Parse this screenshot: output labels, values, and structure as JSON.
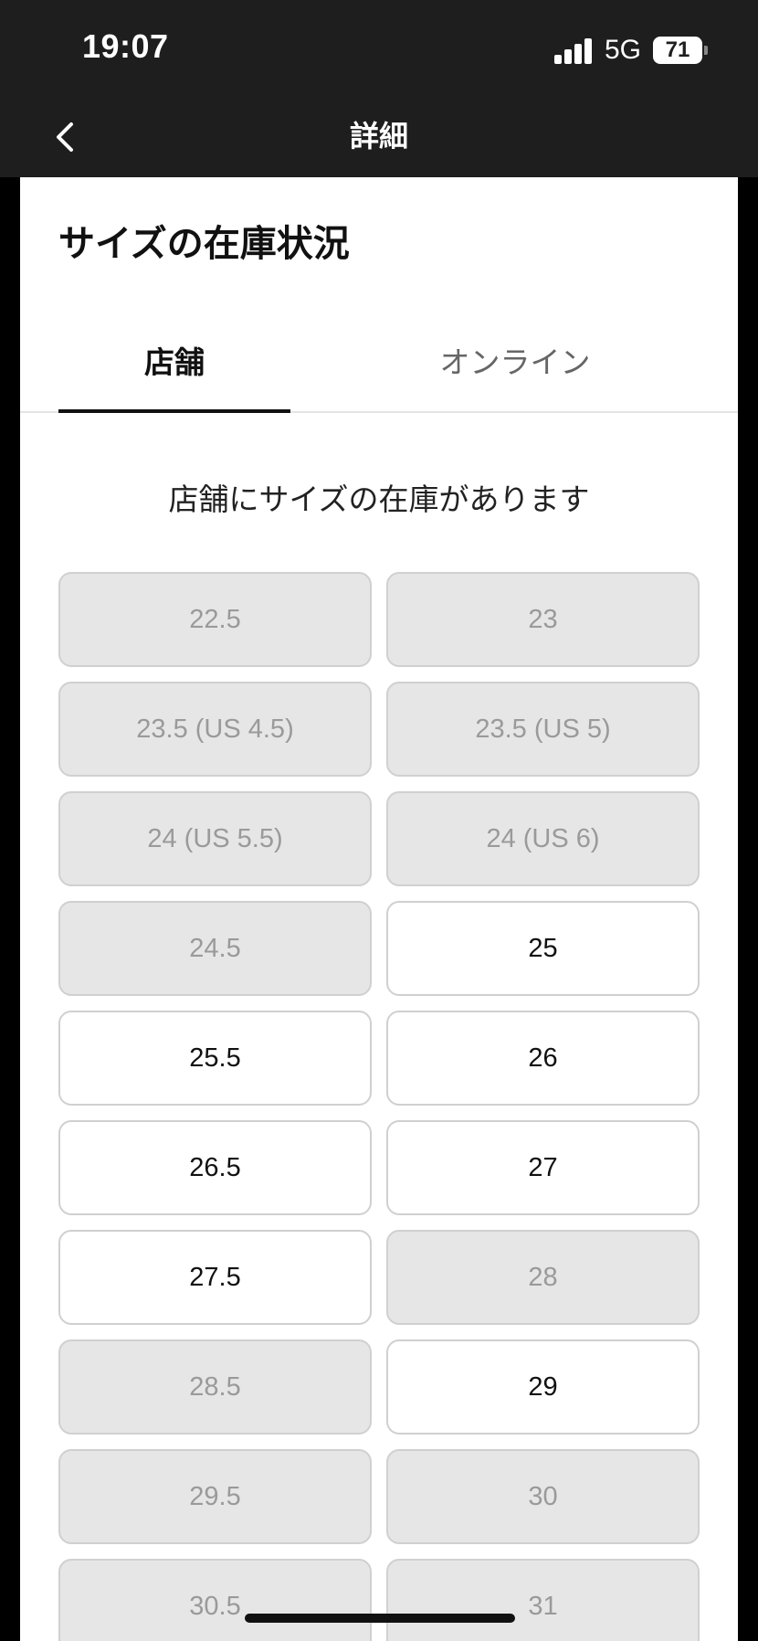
{
  "status_bar": {
    "time": "19:07",
    "network": "5G",
    "battery": "71"
  },
  "nav": {
    "title": "詳細"
  },
  "sheet": {
    "title": "サイズの在庫状況",
    "tabs": [
      {
        "label": "店舗",
        "selected": true
      },
      {
        "label": "オンライン",
        "selected": false
      }
    ],
    "message": "店舗にサイズの在庫があります"
  },
  "sizes": [
    {
      "label": "22.5",
      "available": false
    },
    {
      "label": "23",
      "available": false
    },
    {
      "label": "23.5 (US 4.5)",
      "available": false
    },
    {
      "label": "23.5 (US 5)",
      "available": false
    },
    {
      "label": "24 (US 5.5)",
      "available": false
    },
    {
      "label": "24 (US 6)",
      "available": false
    },
    {
      "label": "24.5",
      "available": false
    },
    {
      "label": "25",
      "available": true
    },
    {
      "label": "25.5",
      "available": true
    },
    {
      "label": "26",
      "available": true
    },
    {
      "label": "26.5",
      "available": true
    },
    {
      "label": "27",
      "available": true
    },
    {
      "label": "27.5",
      "available": true
    },
    {
      "label": "28",
      "available": false
    },
    {
      "label": "28.5",
      "available": false
    },
    {
      "label": "29",
      "available": true
    },
    {
      "label": "29.5",
      "available": false
    },
    {
      "label": "30",
      "available": false
    },
    {
      "label": "30.5",
      "available": false
    },
    {
      "label": "31",
      "available": false
    }
  ],
  "colors": {
    "bar_background": "#1e1e1e",
    "available_background": "#ffffff",
    "unavailable_background": "#e6e6e6",
    "unavailable_text": "#9a9a9a",
    "border": "#d0d0d0"
  }
}
